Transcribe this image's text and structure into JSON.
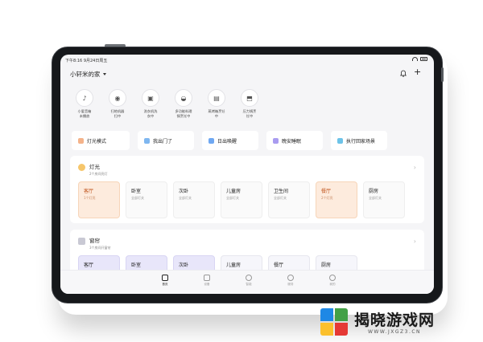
{
  "status_bar": {
    "time": "下午8:16 9月24日周五"
  },
  "header": {
    "home_name": "小轩米的家",
    "bell_icon": "bell-icon",
    "add_icon": "plus-icon"
  },
  "devices": [
    {
      "name": "小爱音箱\n未播放",
      "icon": "speaker-icon",
      "glyph": "♪"
    },
    {
      "name": "扫地机器\n扫中",
      "icon": "robot-vacuum-icon",
      "glyph": "◉"
    },
    {
      "name": "洗衣机洗\n衣中",
      "icon": "washer-icon",
      "glyph": "▣"
    },
    {
      "name": "多功能料理\n锅烹饪中",
      "icon": "cooker-icon",
      "glyph": "◒"
    },
    {
      "name": "蒸烤箱烹饪\n中",
      "icon": "oven-icon",
      "glyph": "▤"
    },
    {
      "name": "压力锅烹\n饪中",
      "icon": "pressure-cooker-icon",
      "glyph": "⬒"
    }
  ],
  "scenes": [
    {
      "label": "灯光模式",
      "color": "#f4b38a",
      "icon": "light-mode-icon"
    },
    {
      "label": "我出门了",
      "color": "#7fb7f0",
      "icon": "leave-home-icon"
    },
    {
      "label": "日出唤醒",
      "color": "#6fa8f2",
      "icon": "sunrise-icon"
    },
    {
      "label": "晚安睡眠",
      "color": "#a99cf0",
      "icon": "sleep-icon"
    },
    {
      "label": "执行回家场景",
      "color": "#6dc3e8",
      "icon": "home-scene-icon"
    }
  ],
  "lights_card": {
    "title": "灯光",
    "subtitle": "2个房间亮灯",
    "icon_color": "#f6c66b",
    "rooms": [
      {
        "name": "客厅",
        "status": "1个灯亮",
        "state": "on"
      },
      {
        "name": "卧室",
        "status": "全部灯关",
        "state": "off"
      },
      {
        "name": "次卧",
        "status": "全部灯关",
        "state": "off"
      },
      {
        "name": "儿童房",
        "status": "全部灯关",
        "state": "off"
      },
      {
        "name": "卫生间",
        "status": "全部灯关",
        "state": "off"
      },
      {
        "name": "餐厅",
        "status": "2个灯亮",
        "state": "on"
      },
      {
        "name": "厨房",
        "status": "全部灯关",
        "state": "off"
      }
    ]
  },
  "curtain_card": {
    "title": "窗帘",
    "subtitle": "3个房间开窗帘",
    "icon_color": "#c9c9d4",
    "rooms": [
      {
        "name": "客厅",
        "state": "lav"
      },
      {
        "name": "卧室",
        "state": "lav"
      },
      {
        "name": "次卧",
        "state": "lav"
      },
      {
        "name": "儿童房",
        "state": "pale"
      },
      {
        "name": "餐厅",
        "state": "pale"
      },
      {
        "name": "厨房",
        "state": "pale"
      }
    ]
  },
  "bottom_nav": [
    {
      "label": "首页",
      "active": true
    },
    {
      "label": "设备",
      "active": false
    },
    {
      "label": "智能",
      "active": false
    },
    {
      "label": "服务",
      "active": false
    },
    {
      "label": "我的",
      "active": false
    }
  ],
  "watermark": {
    "main": "揭晓游戏网",
    "url": "WWW.JXGZ3.CN"
  }
}
